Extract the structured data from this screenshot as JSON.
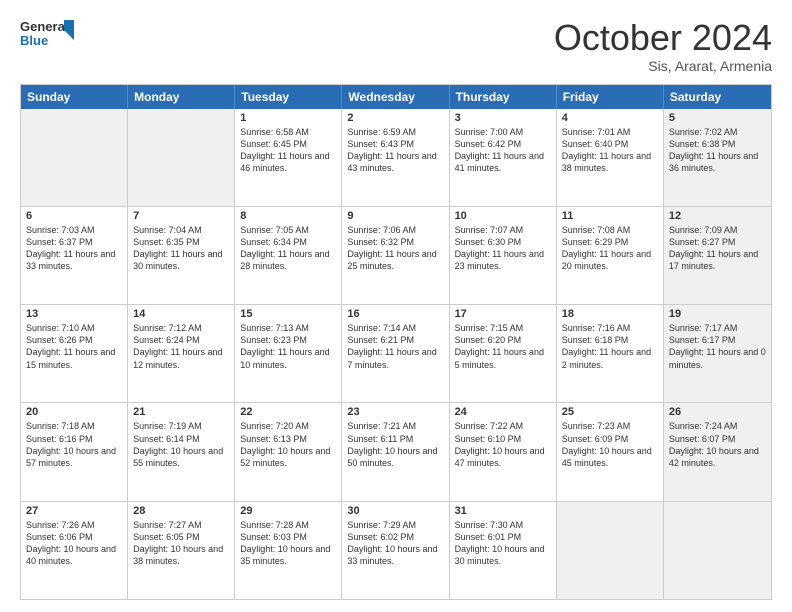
{
  "header": {
    "logo_line1": "General",
    "logo_line2": "Blue",
    "month_title": "October 2024",
    "subtitle": "Sis, Ararat, Armenia"
  },
  "weekdays": [
    "Sunday",
    "Monday",
    "Tuesday",
    "Wednesday",
    "Thursday",
    "Friday",
    "Saturday"
  ],
  "rows": [
    [
      {
        "day": "",
        "sunrise": "",
        "sunset": "",
        "daylight": "",
        "shaded": true
      },
      {
        "day": "",
        "sunrise": "",
        "sunset": "",
        "daylight": "",
        "shaded": true
      },
      {
        "day": "1",
        "sunrise": "Sunrise: 6:58 AM",
        "sunset": "Sunset: 6:45 PM",
        "daylight": "Daylight: 11 hours and 46 minutes.",
        "shaded": false
      },
      {
        "day": "2",
        "sunrise": "Sunrise: 6:59 AM",
        "sunset": "Sunset: 6:43 PM",
        "daylight": "Daylight: 11 hours and 43 minutes.",
        "shaded": false
      },
      {
        "day": "3",
        "sunrise": "Sunrise: 7:00 AM",
        "sunset": "Sunset: 6:42 PM",
        "daylight": "Daylight: 11 hours and 41 minutes.",
        "shaded": false
      },
      {
        "day": "4",
        "sunrise": "Sunrise: 7:01 AM",
        "sunset": "Sunset: 6:40 PM",
        "daylight": "Daylight: 11 hours and 38 minutes.",
        "shaded": false
      },
      {
        "day": "5",
        "sunrise": "Sunrise: 7:02 AM",
        "sunset": "Sunset: 6:38 PM",
        "daylight": "Daylight: 11 hours and 36 minutes.",
        "shaded": true
      }
    ],
    [
      {
        "day": "6",
        "sunrise": "Sunrise: 7:03 AM",
        "sunset": "Sunset: 6:37 PM",
        "daylight": "Daylight: 11 hours and 33 minutes.",
        "shaded": false
      },
      {
        "day": "7",
        "sunrise": "Sunrise: 7:04 AM",
        "sunset": "Sunset: 6:35 PM",
        "daylight": "Daylight: 11 hours and 30 minutes.",
        "shaded": false
      },
      {
        "day": "8",
        "sunrise": "Sunrise: 7:05 AM",
        "sunset": "Sunset: 6:34 PM",
        "daylight": "Daylight: 11 hours and 28 minutes.",
        "shaded": false
      },
      {
        "day": "9",
        "sunrise": "Sunrise: 7:06 AM",
        "sunset": "Sunset: 6:32 PM",
        "daylight": "Daylight: 11 hours and 25 minutes.",
        "shaded": false
      },
      {
        "day": "10",
        "sunrise": "Sunrise: 7:07 AM",
        "sunset": "Sunset: 6:30 PM",
        "daylight": "Daylight: 11 hours and 23 minutes.",
        "shaded": false
      },
      {
        "day": "11",
        "sunrise": "Sunrise: 7:08 AM",
        "sunset": "Sunset: 6:29 PM",
        "daylight": "Daylight: 11 hours and 20 minutes.",
        "shaded": false
      },
      {
        "day": "12",
        "sunrise": "Sunrise: 7:09 AM",
        "sunset": "Sunset: 6:27 PM",
        "daylight": "Daylight: 11 hours and 17 minutes.",
        "shaded": true
      }
    ],
    [
      {
        "day": "13",
        "sunrise": "Sunrise: 7:10 AM",
        "sunset": "Sunset: 6:26 PM",
        "daylight": "Daylight: 11 hours and 15 minutes.",
        "shaded": false
      },
      {
        "day": "14",
        "sunrise": "Sunrise: 7:12 AM",
        "sunset": "Sunset: 6:24 PM",
        "daylight": "Daylight: 11 hours and 12 minutes.",
        "shaded": false
      },
      {
        "day": "15",
        "sunrise": "Sunrise: 7:13 AM",
        "sunset": "Sunset: 6:23 PM",
        "daylight": "Daylight: 11 hours and 10 minutes.",
        "shaded": false
      },
      {
        "day": "16",
        "sunrise": "Sunrise: 7:14 AM",
        "sunset": "Sunset: 6:21 PM",
        "daylight": "Daylight: 11 hours and 7 minutes.",
        "shaded": false
      },
      {
        "day": "17",
        "sunrise": "Sunrise: 7:15 AM",
        "sunset": "Sunset: 6:20 PM",
        "daylight": "Daylight: 11 hours and 5 minutes.",
        "shaded": false
      },
      {
        "day": "18",
        "sunrise": "Sunrise: 7:16 AM",
        "sunset": "Sunset: 6:18 PM",
        "daylight": "Daylight: 11 hours and 2 minutes.",
        "shaded": false
      },
      {
        "day": "19",
        "sunrise": "Sunrise: 7:17 AM",
        "sunset": "Sunset: 6:17 PM",
        "daylight": "Daylight: 11 hours and 0 minutes.",
        "shaded": true
      }
    ],
    [
      {
        "day": "20",
        "sunrise": "Sunrise: 7:18 AM",
        "sunset": "Sunset: 6:16 PM",
        "daylight": "Daylight: 10 hours and 57 minutes.",
        "shaded": false
      },
      {
        "day": "21",
        "sunrise": "Sunrise: 7:19 AM",
        "sunset": "Sunset: 6:14 PM",
        "daylight": "Daylight: 10 hours and 55 minutes.",
        "shaded": false
      },
      {
        "day": "22",
        "sunrise": "Sunrise: 7:20 AM",
        "sunset": "Sunset: 6:13 PM",
        "daylight": "Daylight: 10 hours and 52 minutes.",
        "shaded": false
      },
      {
        "day": "23",
        "sunrise": "Sunrise: 7:21 AM",
        "sunset": "Sunset: 6:11 PM",
        "daylight": "Daylight: 10 hours and 50 minutes.",
        "shaded": false
      },
      {
        "day": "24",
        "sunrise": "Sunrise: 7:22 AM",
        "sunset": "Sunset: 6:10 PM",
        "daylight": "Daylight: 10 hours and 47 minutes.",
        "shaded": false
      },
      {
        "day": "25",
        "sunrise": "Sunrise: 7:23 AM",
        "sunset": "Sunset: 6:09 PM",
        "daylight": "Daylight: 10 hours and 45 minutes.",
        "shaded": false
      },
      {
        "day": "26",
        "sunrise": "Sunrise: 7:24 AM",
        "sunset": "Sunset: 6:07 PM",
        "daylight": "Daylight: 10 hours and 42 minutes.",
        "shaded": true
      }
    ],
    [
      {
        "day": "27",
        "sunrise": "Sunrise: 7:26 AM",
        "sunset": "Sunset: 6:06 PM",
        "daylight": "Daylight: 10 hours and 40 minutes.",
        "shaded": false
      },
      {
        "day": "28",
        "sunrise": "Sunrise: 7:27 AM",
        "sunset": "Sunset: 6:05 PM",
        "daylight": "Daylight: 10 hours and 38 minutes.",
        "shaded": false
      },
      {
        "day": "29",
        "sunrise": "Sunrise: 7:28 AM",
        "sunset": "Sunset: 6:03 PM",
        "daylight": "Daylight: 10 hours and 35 minutes.",
        "shaded": false
      },
      {
        "day": "30",
        "sunrise": "Sunrise: 7:29 AM",
        "sunset": "Sunset: 6:02 PM",
        "daylight": "Daylight: 10 hours and 33 minutes.",
        "shaded": false
      },
      {
        "day": "31",
        "sunrise": "Sunrise: 7:30 AM",
        "sunset": "Sunset: 6:01 PM",
        "daylight": "Daylight: 10 hours and 30 minutes.",
        "shaded": false
      },
      {
        "day": "",
        "sunrise": "",
        "sunset": "",
        "daylight": "",
        "shaded": true
      },
      {
        "day": "",
        "sunrise": "",
        "sunset": "",
        "daylight": "",
        "shaded": true
      }
    ]
  ]
}
